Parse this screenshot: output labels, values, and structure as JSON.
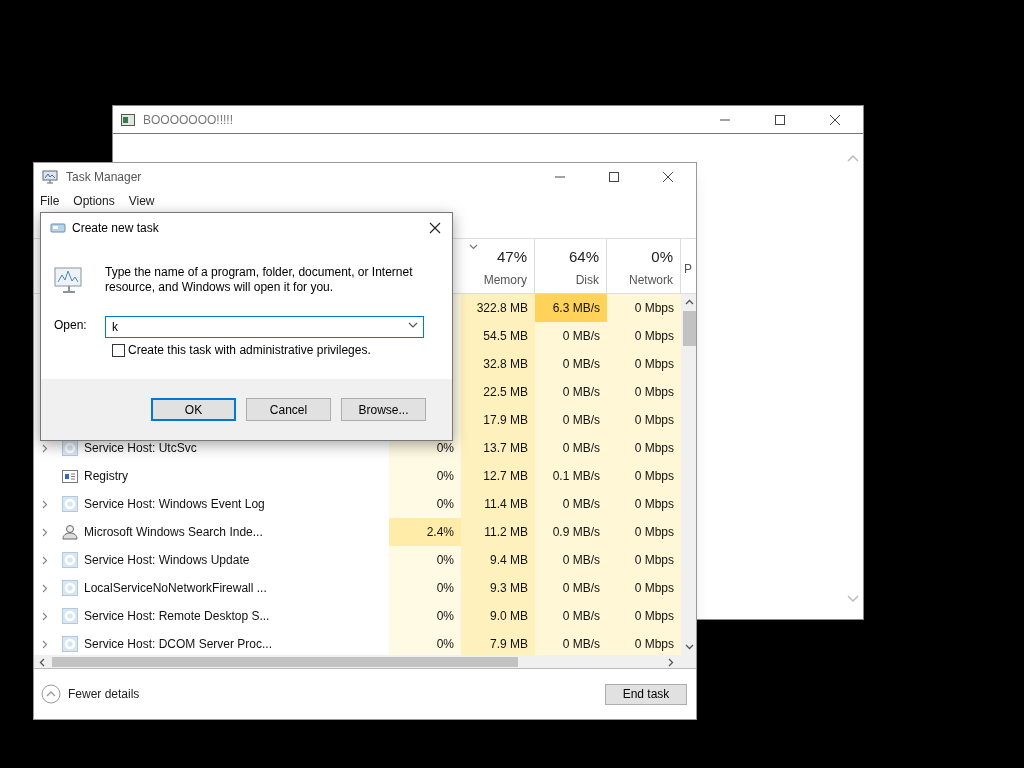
{
  "boo_window": {
    "title": "BOOOOOOO!!!!!"
  },
  "task_manager": {
    "title": "Task Manager",
    "menu": [
      "File",
      "Options",
      "View"
    ],
    "columns": [
      {
        "percent": "47%",
        "label": "Memory",
        "sorted": true
      },
      {
        "percent": "64%",
        "label": "Disk",
        "sorted": false
      },
      {
        "percent": "0%",
        "label": "Network",
        "sorted": false
      },
      {
        "label": "P"
      }
    ],
    "rows": [
      {
        "memory": "322.8 MB",
        "disk": "6.3 MB/s",
        "network": "0 Mbps",
        "disk_hot": true,
        "cpu_hot": false
      },
      {
        "memory": "54.5 MB",
        "disk": "0 MB/s",
        "network": "0 Mbps",
        "disk_hot": false,
        "cpu_hot": false
      },
      {
        "memory": "32.8 MB",
        "disk": "0 MB/s",
        "network": "0 Mbps",
        "disk_hot": false,
        "cpu_hot": false
      },
      {
        "memory": "22.5 MB",
        "disk": "0 MB/s",
        "network": "0 Mbps",
        "disk_hot": false,
        "cpu_hot": false
      },
      {
        "memory": "17.9 MB",
        "disk": "0 MB/s",
        "network": "0 Mbps",
        "disk_hot": false,
        "cpu_hot": false
      },
      {
        "name": "Service Host: UtcSvc",
        "kind": "service",
        "expandable": true,
        "cpu": "0%",
        "memory": "13.7 MB",
        "disk": "0 MB/s",
        "network": "0 Mbps",
        "disk_hot": false,
        "cpu_hot": false
      },
      {
        "name": "Registry",
        "kind": "registry",
        "expandable": false,
        "cpu": "0%",
        "memory": "12.7 MB",
        "disk": "0.1 MB/s",
        "network": "0 Mbps",
        "disk_hot": false,
        "cpu_hot": false
      },
      {
        "name": "Service Host: Windows Event Log",
        "kind": "service",
        "expandable": true,
        "cpu": "0%",
        "memory": "11.4 MB",
        "disk": "0 MB/s",
        "network": "0 Mbps",
        "disk_hot": false,
        "cpu_hot": false
      },
      {
        "name": "Microsoft Windows Search Inde...",
        "kind": "indexer",
        "expandable": true,
        "cpu": "2.4%",
        "memory": "11.2 MB",
        "disk": "0.9 MB/s",
        "network": "0 Mbps",
        "disk_hot": false,
        "cpu_hot": true
      },
      {
        "name": "Service Host: Windows Update",
        "kind": "service",
        "expandable": true,
        "cpu": "0%",
        "memory": "9.4 MB",
        "disk": "0 MB/s",
        "network": "0 Mbps",
        "disk_hot": false,
        "cpu_hot": false
      },
      {
        "name": "LocalServiceNoNetworkFirewall ...",
        "kind": "service",
        "expandable": true,
        "cpu": "0%",
        "memory": "9.3 MB",
        "disk": "0 MB/s",
        "network": "0 Mbps",
        "disk_hot": false,
        "cpu_hot": false
      },
      {
        "name": "Service Host: Remote Desktop S...",
        "kind": "service",
        "expandable": true,
        "cpu": "0%",
        "memory": "9.0 MB",
        "disk": "0 MB/s",
        "network": "0 Mbps",
        "disk_hot": false,
        "cpu_hot": false
      },
      {
        "name": "Service Host: DCOM Server Proc...",
        "kind": "service",
        "expandable": true,
        "cpu": "0%",
        "memory": "7.9 MB",
        "disk": "0 MB/s",
        "network": "0 Mbps",
        "disk_hot": false,
        "cpu_hot": false
      }
    ],
    "fewer_details": "Fewer details",
    "end_task": "End task"
  },
  "dialog": {
    "title": "Create new task",
    "message": "Type the name of a program, folder, document, or Internet resource, and Windows will open it for you.",
    "open_label": "Open:",
    "value": "k",
    "checkbox": {
      "label": "Create this task with administrative privileges.",
      "checked": false
    },
    "buttons": [
      {
        "label": "OK",
        "default": true
      },
      {
        "label": "Cancel",
        "default": false
      },
      {
        "label": "Browse...",
        "default": false
      }
    ]
  }
}
